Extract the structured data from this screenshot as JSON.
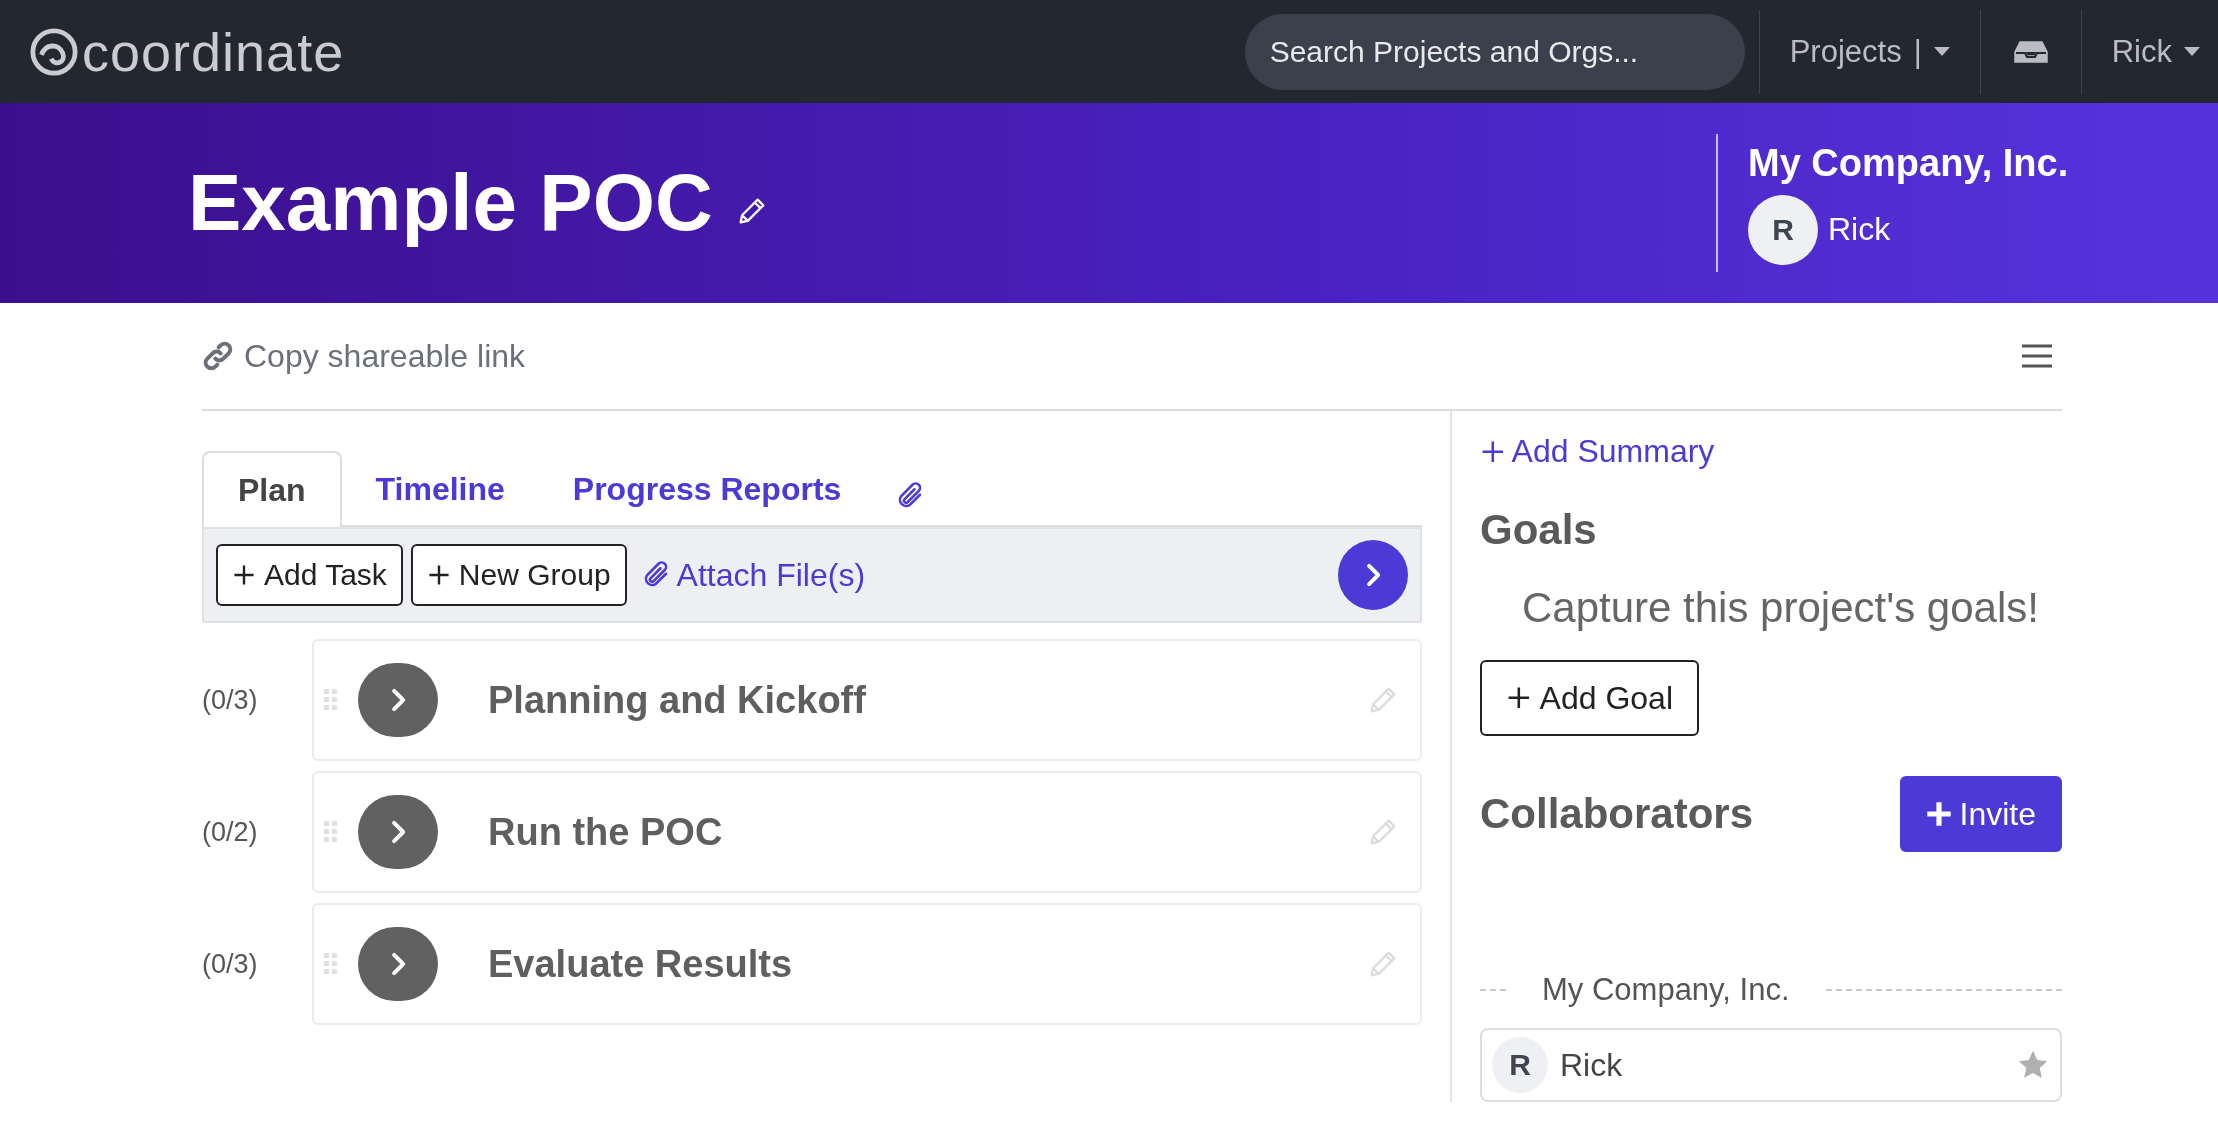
{
  "topbar": {
    "logo": "coordinate",
    "search": {
      "placeholder": "Search Projects and Orgs..."
    },
    "projects_menu": "Projects",
    "projects_separator": "|",
    "user_menu": "Rick"
  },
  "header": {
    "title": "Example POC",
    "org": "My Company, Inc.",
    "owner": {
      "initial": "R",
      "name": "Rick"
    }
  },
  "share_link": "Copy shareable link",
  "tabs": [
    {
      "label": "Plan",
      "selected": true
    },
    {
      "label": "Timeline",
      "selected": false
    },
    {
      "label": "Progress Reports",
      "selected": false
    }
  ],
  "toolbar": {
    "buttons": [
      "Add Task",
      "New Group"
    ],
    "attach": "Attach File(s)"
  },
  "groups": [
    {
      "count": "(0/3)",
      "title": "Planning and Kickoff"
    },
    {
      "count": "(0/2)",
      "title": "Run the POC"
    },
    {
      "count": "(0/3)",
      "title": "Evaluate Results"
    }
  ],
  "sidebar": {
    "add_summary": "Add Summary",
    "goals_heading": "Goals",
    "goals_empty": "Capture this project's goals!",
    "add_goal": "Add Goal",
    "collaborators_heading": "Collaborators",
    "invite": "Invite",
    "org_divider": "My Company, Inc.",
    "collaborators": [
      {
        "initial": "R",
        "name": "Rick"
      }
    ]
  }
}
